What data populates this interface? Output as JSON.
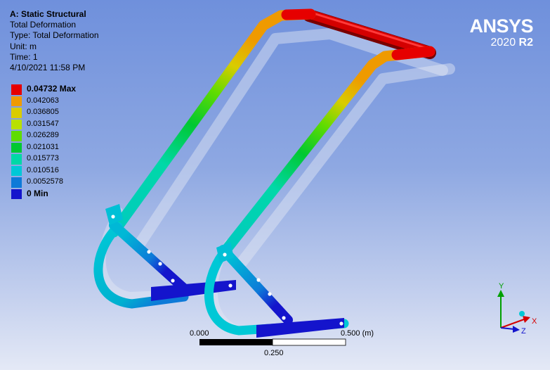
{
  "info": {
    "title": "A: Static Structural",
    "lines": [
      "Total Deformation",
      "Type: Total Deformation",
      "Unit: m",
      "Time: 1",
      "4/10/2021 11:58 PM"
    ]
  },
  "legend": {
    "entries": [
      {
        "label": "0.04732 Max",
        "color": "#e60000",
        "bold": true
      },
      {
        "label": "0.042063",
        "color": "#ef9a00"
      },
      {
        "label": "0.036805",
        "color": "#d9cc00"
      },
      {
        "label": "0.031547",
        "color": "#b8e000"
      },
      {
        "label": "0.026289",
        "color": "#5fdc00"
      },
      {
        "label": "0.021031",
        "color": "#00c832"
      },
      {
        "label": "0.015773",
        "color": "#00d8a6"
      },
      {
        "label": "0.010516",
        "color": "#00c8d6"
      },
      {
        "label": "0.0052578",
        "color": "#0d7ad8"
      },
      {
        "label": "0 Min",
        "color": "#1414cc",
        "bold": true
      }
    ]
  },
  "brand": {
    "name": "ANSYS",
    "version": "2020",
    "release": "R2"
  },
  "scale_bar": {
    "start": "0.000",
    "mid": "0.250",
    "end": "0.500 (m)"
  },
  "triad": {
    "x": "X",
    "y": "Y",
    "z": "Z"
  }
}
